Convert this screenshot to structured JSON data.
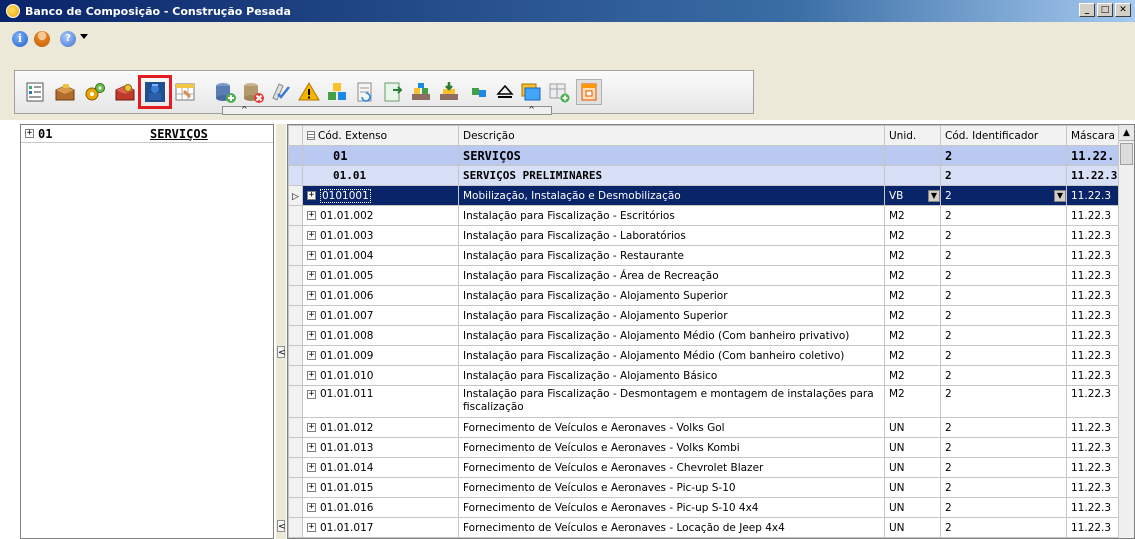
{
  "window": {
    "title": "Banco de Composição - Construção Pesada",
    "buttons": [
      "_",
      "□",
      "✕"
    ]
  },
  "menu_icons": [
    "info-icon",
    "user-icon",
    "help-icon"
  ],
  "toolbar": {
    "buttons": [
      "properties-icon",
      "box-open-icon",
      "gear-multi-icon",
      "box-gear-icon",
      "computer-user-icon",
      "calendar-table-icon",
      "database-add-icon",
      "database-remove-icon",
      "checklist-icon",
      "warning-icon",
      "blocks-icon",
      "document-refresh-icon",
      "export-green-icon",
      "stack-blocks-icon",
      "stack-arrow-icon",
      "link-icon",
      "eject-icon",
      "doc-stack-icon",
      "table-add-icon",
      "copy-window-icon"
    ],
    "selected_index": 4
  },
  "tree": {
    "items": [
      {
        "code": "01",
        "label": "SERVIÇOS"
      }
    ]
  },
  "grid": {
    "columns": [
      "Cód. Extenso",
      "Descrição",
      "Unid.",
      "Cód. Identificador",
      "Máscara"
    ],
    "groups": [
      {
        "code": "01",
        "desc": "SERVIÇOS",
        "ident": "2",
        "mask": "11.22."
      },
      {
        "code": "01.01",
        "desc": "SERVIÇOS PRELIMINARES",
        "ident": "2",
        "mask": "11.22.3"
      }
    ],
    "rows": [
      {
        "code": "0101001",
        "desc": "Mobilização, Instalação e  Desmobilização",
        "unit": "VB",
        "ident": "2",
        "mask": "11.22.3"
      },
      {
        "code": "01.01.002",
        "desc": "Instalação para Fiscalização - Escritórios",
        "unit": "M2",
        "ident": "2",
        "mask": "11.22.3"
      },
      {
        "code": "01.01.003",
        "desc": "Instalação para Fiscalização - Laboratórios",
        "unit": "M2",
        "ident": "2",
        "mask": "11.22.3"
      },
      {
        "code": "01.01.004",
        "desc": "Instalação para Fiscalização - Restaurante",
        "unit": "M2",
        "ident": "2",
        "mask": "11.22.3"
      },
      {
        "code": "01.01.005",
        "desc": "Instalação para Fiscalização - Área de Recreação",
        "unit": "M2",
        "ident": "2",
        "mask": "11.22.3"
      },
      {
        "code": "01.01.006",
        "desc": "Instalação para Fiscalização - Alojamento Superior",
        "unit": "M2",
        "ident": "2",
        "mask": "11.22.3"
      },
      {
        "code": "01.01.007",
        "desc": "Instalação para Fiscalização - Alojamento Superior",
        "unit": "M2",
        "ident": "2",
        "mask": "11.22.3"
      },
      {
        "code": "01.01.008",
        "desc": "Instalação para Fiscalização - Alojamento Médio (Com banheiro privativo)",
        "unit": "M2",
        "ident": "2",
        "mask": "11.22.3"
      },
      {
        "code": "01.01.009",
        "desc": "Instalação para Fiscalização - Alojamento Médio (Com banheiro coletivo)",
        "unit": "M2",
        "ident": "2",
        "mask": "11.22.3"
      },
      {
        "code": "01.01.010",
        "desc": "Instalação para Fiscalização - Alojamento Básico",
        "unit": "M2",
        "ident": "2",
        "mask": "11.22.3"
      },
      {
        "code": "01.01.011",
        "desc": "Instalação para Fiscalização - Desmontagem e montagem de instalações para fiscalização",
        "unit": "M2",
        "ident": "2",
        "mask": "11.22.3"
      },
      {
        "code": "01.01.012",
        "desc": "Fornecimento de Veículos e  Aeronaves - Volks Gol",
        "unit": "UN",
        "ident": "2",
        "mask": "11.22.3"
      },
      {
        "code": "01.01.013",
        "desc": "Fornecimento de Veículos e  Aeronaves - Volks Kombi",
        "unit": "UN",
        "ident": "2",
        "mask": "11.22.3"
      },
      {
        "code": "01.01.014",
        "desc": "Fornecimento de Veículos e  Aeronaves - Chevrolet Blazer",
        "unit": "UN",
        "ident": "2",
        "mask": "11.22.3"
      },
      {
        "code": "01.01.015",
        "desc": "Fornecimento de Veículos e  Aeronaves - Pic-up S-10",
        "unit": "UN",
        "ident": "2",
        "mask": "11.22.3"
      },
      {
        "code": "01.01.016",
        "desc": "Fornecimento de Veículos e  Aeronaves - Pic-up S-10 4x4",
        "unit": "UN",
        "ident": "2",
        "mask": "11.22.3"
      },
      {
        "code": "01.01.017",
        "desc": "Fornecimento de Veículos e  Aeronaves - Locação de Jeep 4x4",
        "unit": "UN",
        "ident": "2",
        "mask": "11.22.3"
      }
    ]
  }
}
